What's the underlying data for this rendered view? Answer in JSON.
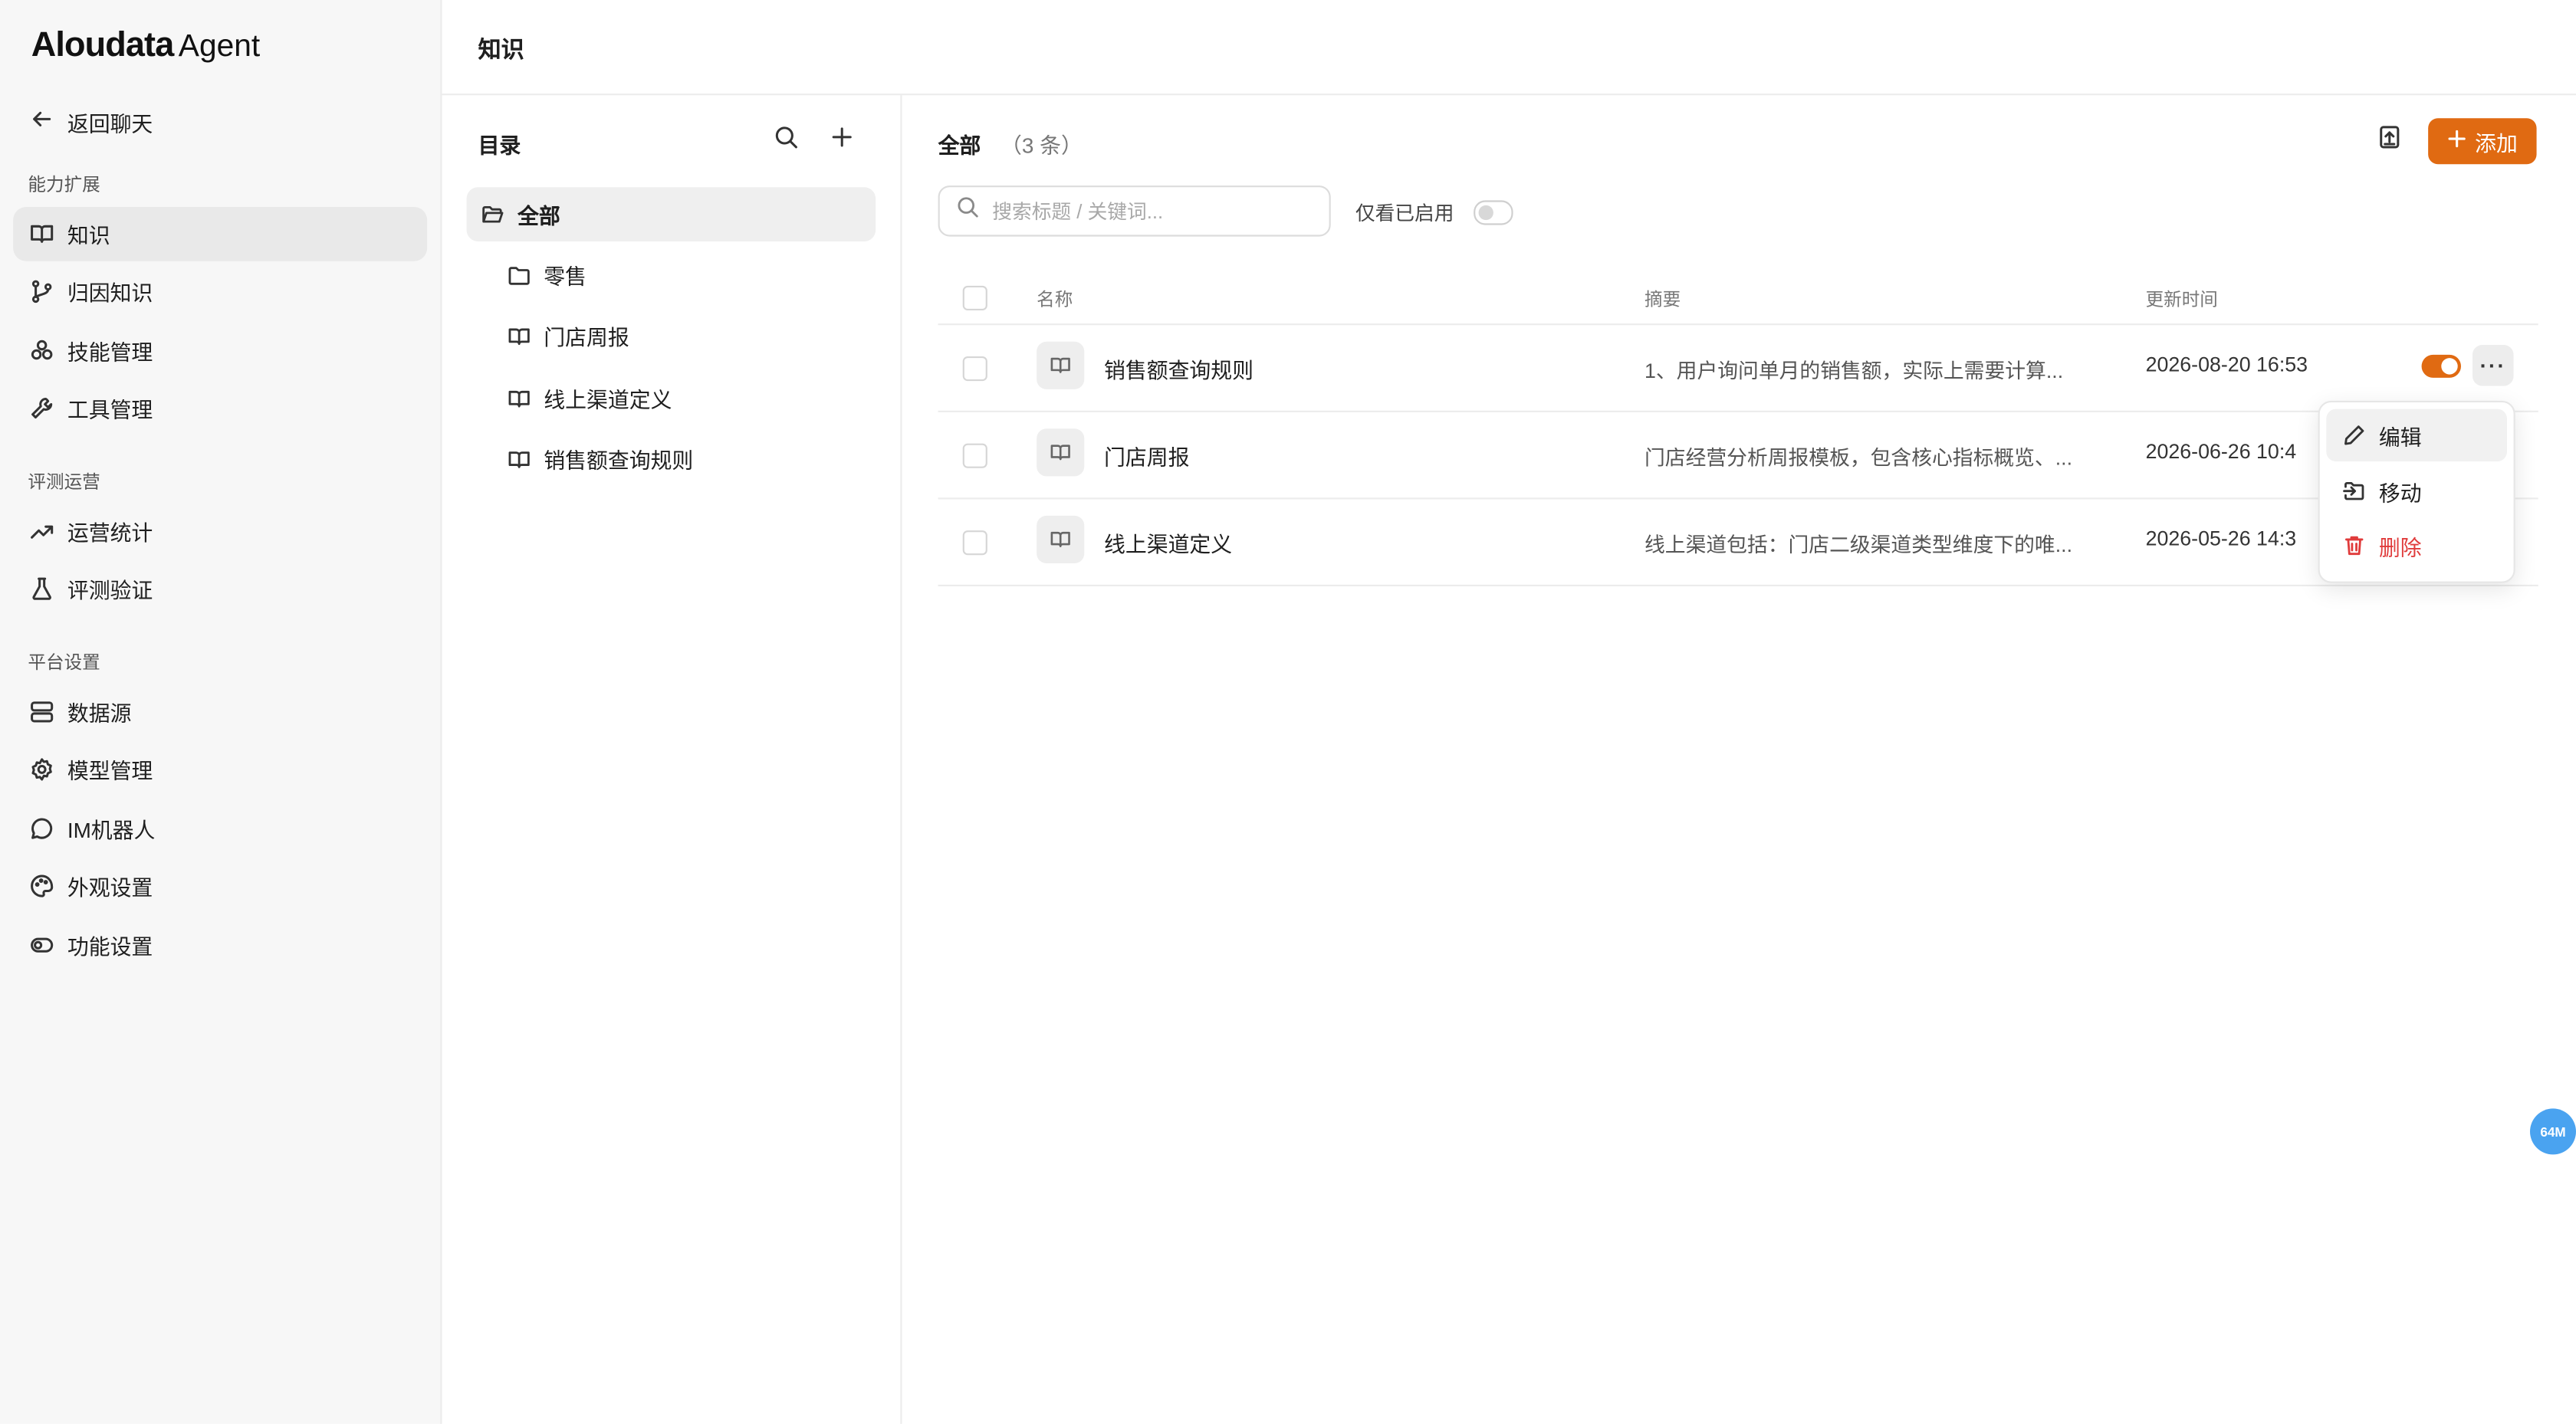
{
  "brand": {
    "name": "Aloudata",
    "suffix": "Agent"
  },
  "sidebar": {
    "back_label": "返回聊天",
    "sections": [
      {
        "title": "能力扩展",
        "items": [
          {
            "label": "知识",
            "icon": "book-icon"
          },
          {
            "label": "归因知识",
            "icon": "git-branch-icon"
          },
          {
            "label": "技能管理",
            "icon": "skills-icon"
          },
          {
            "label": "工具管理",
            "icon": "wrench-icon"
          }
        ]
      },
      {
        "title": "评测运营",
        "items": [
          {
            "label": "运营统计",
            "icon": "trend-icon"
          },
          {
            "label": "评测验证",
            "icon": "flask-icon"
          }
        ]
      },
      {
        "title": "平台设置",
        "items": [
          {
            "label": "数据源",
            "icon": "database-icon"
          },
          {
            "label": "模型管理",
            "icon": "gear-icon"
          },
          {
            "label": "IM机器人",
            "icon": "chat-icon"
          },
          {
            "label": "外观设置",
            "icon": "palette-icon"
          },
          {
            "label": "功能设置",
            "icon": "toggle-icon"
          }
        ]
      }
    ],
    "active": "知识"
  },
  "page": {
    "title": "知识"
  },
  "catalog": {
    "title": "目录",
    "tree": [
      {
        "label": "全部",
        "icon": "folder-open-icon",
        "active": true
      },
      {
        "label": "零售",
        "icon": "folder-icon"
      },
      {
        "label": "门店周报",
        "icon": "book-icon"
      },
      {
        "label": "线上渠道定义",
        "icon": "book-icon"
      },
      {
        "label": "销售额查询规则",
        "icon": "book-icon"
      }
    ]
  },
  "main": {
    "heading": "全部",
    "count": "（3 条）",
    "add_label": "添加",
    "search_placeholder": "搜索标题 / 关键词...",
    "filter_label": "仅看已启用",
    "columns": [
      "名称",
      "摘要",
      "更新时间"
    ],
    "rows": [
      {
        "name": "销售额查询规则",
        "summary": "1、用户询问单月的销售额，实际上需要计算...",
        "time": "2026-08-20 16:53",
        "enabled": true
      },
      {
        "name": "门店周报",
        "summary": "门店经营分析周报模板，包含核心指标概览、...",
        "time": "2026-06-26 10:4"
      },
      {
        "name": "线上渠道定义",
        "summary": "线上渠道包括：门店二级渠道类型维度下的唯...",
        "time": "2026-05-26 14:3"
      }
    ]
  },
  "menu": {
    "edit": "编辑",
    "move": "移动",
    "delete": "删除"
  },
  "badge": "64M",
  "colors": {
    "accent": "#e06a12",
    "danger": "#e03b3b",
    "badge": "#4aa3f0"
  }
}
